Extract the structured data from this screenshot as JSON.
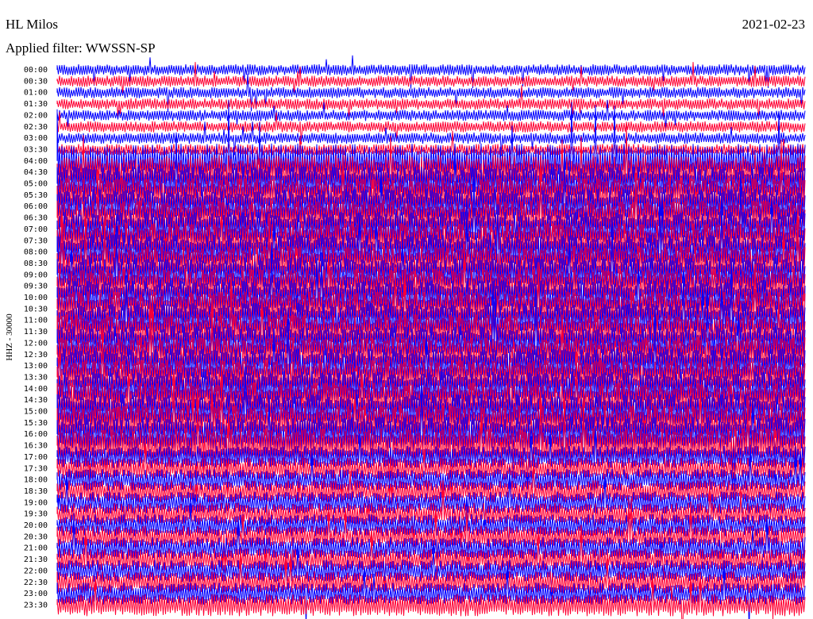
{
  "header": {
    "station": "HL Milos",
    "date": "2021-02-23",
    "filter_text": "Applied filter: WWSSN-SP"
  },
  "chart_data": {
    "type": "line",
    "title": "HL Milos",
    "subtitle": "Applied filter: WWSSN-SP",
    "date": "2021-02-23",
    "ylabel": "HHZ - 30000",
    "xlabel": "",
    "y_tick_labels": [
      "00:00",
      "00:30",
      "01:00",
      "01:30",
      "02:00",
      "02:30",
      "03:00",
      "03:30",
      "04:00",
      "04:30",
      "05:00",
      "05:30",
      "06:00",
      "06:30",
      "07:00",
      "07:30",
      "08:00",
      "08:30",
      "09:00",
      "09:30",
      "10:00",
      "10:30",
      "11:00",
      "11:30",
      "12:00",
      "12:30",
      "13:00",
      "13:30",
      "14:00",
      "14:30",
      "15:00",
      "15:30",
      "16:00",
      "16:30",
      "17:00",
      "17:30",
      "18:00",
      "18:30",
      "19:00",
      "19:30",
      "20:00",
      "20:30",
      "21:00",
      "21:30",
      "22:00",
      "22:30",
      "23:00",
      "23:30"
    ],
    "trace_colors": [
      "#0000ff",
      "#ff0033"
    ],
    "row_minutes": 30,
    "grid": false,
    "legend": "none"
  }
}
